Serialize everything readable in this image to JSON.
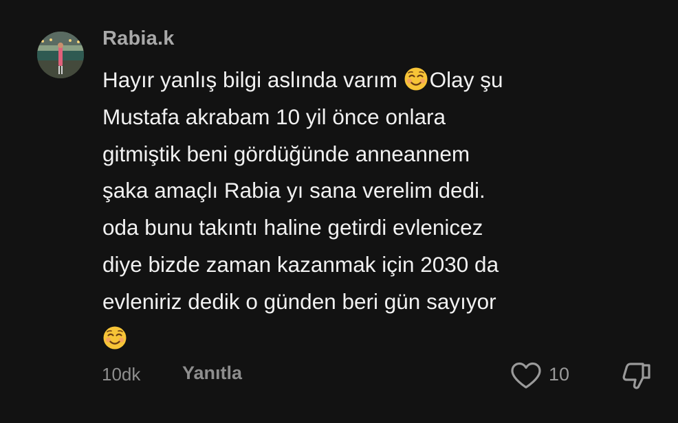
{
  "comment": {
    "username": "Rabia.k",
    "avatar_icon": "profile-photo",
    "lines": [
      {
        "text": "Hayır yanlış bilgi aslında varım ",
        "emoji": "smiling-face-icon",
        "after": "Olay şu"
      },
      {
        "text": "Mustafa akrabam 10 yil önce onlara"
      },
      {
        "text": "gitmiştik beni gördüğünde anneannem"
      },
      {
        "text": "şaka amaçlı Rabia yı sana verelim dedi."
      },
      {
        "text": "oda bunu takıntı haline getirdi evlenicez"
      },
      {
        "text": "diye bizde zaman kazanmak için 2030 da"
      },
      {
        "text": "evleniriz dedik o günden beri gün sayıyor"
      },
      {
        "text": "",
        "emoji": "smiling-face-icon"
      }
    ],
    "timestamp": "10dk",
    "reply_label": "Yanıtla",
    "like_count": "10",
    "like_icon": "heart-outline-icon",
    "dislike_icon": "thumbs-down-icon"
  },
  "colors": {
    "background": "#121212",
    "text": "#f1f1f1",
    "muted": "#8e8e8e",
    "username": "#a9a9a9"
  }
}
